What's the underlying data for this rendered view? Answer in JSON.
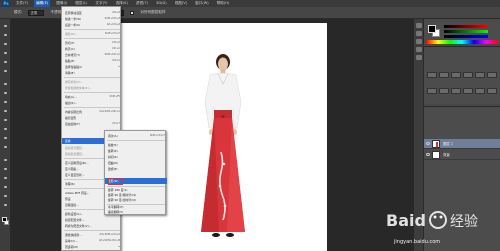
{
  "app": {
    "logo_text": "Ps"
  },
  "menubar": {
    "items": [
      "文件(F)",
      "编辑(E)",
      "图像(I)",
      "图层(L)",
      "文字(Y)",
      "选择(S)",
      "滤镜(T)",
      "3D(D)",
      "视图(V)",
      "窗口(W)",
      "帮助(H)"
    ],
    "active_index": 1
  },
  "options": {
    "mode_label": "模式:",
    "mode_value": "正常",
    "opacity_label": "不透明度:",
    "opacity_value": "100%",
    "flow_label": "流量:",
    "flow_value": "100%",
    "check_label": "对所有图层取样"
  },
  "edit_menu": {
    "items": [
      {
        "label": "还原移动选区",
        "shortcut": "Ctrl+Z",
        "dim": false
      },
      {
        "label": "前进一步(W)",
        "shortcut": "Shift+Ctrl+Z",
        "dim": false
      },
      {
        "label": "后退一步(K)",
        "shortcut": "Alt+Ctrl+Z",
        "dim": false
      },
      {
        "label": "渐隐(D)...",
        "shortcut": "Shift+Ctrl+F",
        "dim": true
      },
      {
        "label": "剪切(T)",
        "shortcut": "Ctrl+X",
        "dim": false
      },
      {
        "label": "拷贝(C)",
        "shortcut": "Ctrl+C",
        "dim": false
      },
      {
        "label": "合并拷贝(Y)",
        "shortcut": "Shift+Ctrl+C",
        "dim": false
      },
      {
        "label": "粘贴(P)",
        "shortcut": "Ctrl+V",
        "dim": false
      },
      {
        "label": "选择性粘贴(I)",
        "shortcut": "",
        "dim": false
      },
      {
        "label": "清除(E)",
        "shortcut": "",
        "dim": false
      },
      {
        "label": "拼写检查(H)...",
        "shortcut": "",
        "dim": true
      },
      {
        "label": "查找和替换文本(X)...",
        "shortcut": "",
        "dim": true
      },
      {
        "label": "填充(L)...",
        "shortcut": "Shift+F5",
        "dim": false
      },
      {
        "label": "描边(S)...",
        "shortcut": "",
        "dim": false
      },
      {
        "label": "内容识别比例",
        "shortcut": "Alt+Shift+Ctrl+C",
        "dim": false
      },
      {
        "label": "操控变形",
        "shortcut": "",
        "dim": false
      },
      {
        "label": "自由变换(F)",
        "shortcut": "Ctrl+T",
        "dim": false
      },
      {
        "label": "变换",
        "shortcut": "",
        "dim": false
      },
      {
        "label": "自动对齐图层...",
        "shortcut": "",
        "dim": true
      },
      {
        "label": "自动混合图层...",
        "shortcut": "",
        "dim": true
      },
      {
        "label": "定义画笔预设(B)...",
        "shortcut": "",
        "dim": false
      },
      {
        "label": "定义图案...",
        "shortcut": "",
        "dim": false
      },
      {
        "label": "定义自定形状...",
        "shortcut": "",
        "dim": false
      },
      {
        "label": "清理(R)",
        "shortcut": "",
        "dim": false
      },
      {
        "label": "Adobe PDF 预设...",
        "shortcut": "",
        "dim": false
      },
      {
        "label": "预设",
        "shortcut": "",
        "dim": false
      },
      {
        "label": "远程连接...",
        "shortcut": "",
        "dim": false
      },
      {
        "label": "颜色设置(G)...",
        "shortcut": "Shift+Ctrl+K",
        "dim": false
      },
      {
        "label": "指定配置文件...",
        "shortcut": "",
        "dim": false
      },
      {
        "label": "转换为配置文件(V)...",
        "shortcut": "",
        "dim": false
      },
      {
        "label": "键盘快捷键...",
        "shortcut": "Alt+Shift+Ctrl+K",
        "dim": false
      },
      {
        "label": "菜单(U)...",
        "shortcut": "Alt+Shift+Ctrl+M",
        "dim": false
      },
      {
        "label": "首选项(N)",
        "shortcut": "",
        "dim": false
      }
    ],
    "highlighted": "变换"
  },
  "transform_submenu": {
    "items": [
      {
        "label": "再次(A)",
        "shortcut": "Shift+Ctrl+T"
      },
      {
        "label": "缩放(S)",
        "shortcut": ""
      },
      {
        "label": "旋转(R)",
        "shortcut": ""
      },
      {
        "label": "斜切(K)",
        "shortcut": ""
      },
      {
        "label": "扭曲(D)",
        "shortcut": ""
      },
      {
        "label": "透视(P)",
        "shortcut": ""
      },
      {
        "label": "变形(W)",
        "shortcut": ""
      },
      {
        "label": "旋转 180 度(1)",
        "shortcut": ""
      },
      {
        "label": "旋转 90 度(顺时针)(9)",
        "shortcut": ""
      },
      {
        "label": "旋转 90 度(逆时针)(0)",
        "shortcut": ""
      },
      {
        "label": "水平翻转(H)",
        "shortcut": ""
      },
      {
        "label": "垂直翻转(V)",
        "shortcut": ""
      }
    ],
    "highlighted": "变形(W)"
  },
  "layers": {
    "rows": [
      {
        "name": "图层 1",
        "selected": true
      },
      {
        "name": "背景",
        "selected": false
      }
    ]
  },
  "watermark": {
    "brand": "Baidu 经验",
    "url": "jingyan.baidu.com"
  }
}
